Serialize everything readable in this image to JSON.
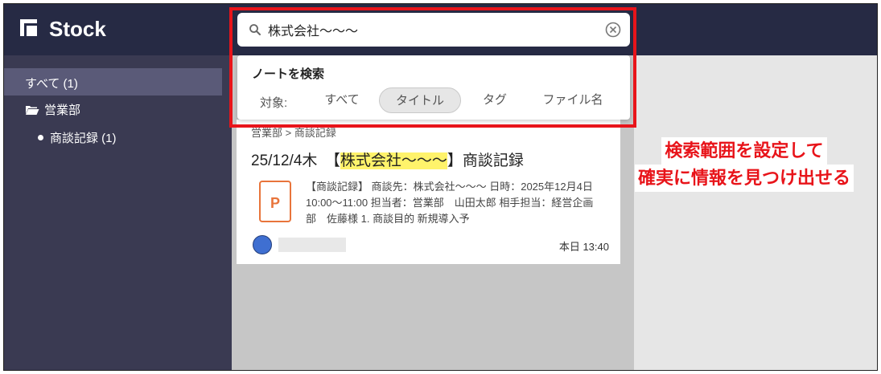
{
  "app": {
    "logo_text": "Stock"
  },
  "colors": {
    "topbar": "#262a44",
    "sidebar": "#3a3a52",
    "sidebar_selected": "#5a5a78",
    "highlight": "#fff36b",
    "annotation_red": "#e8141a",
    "file_icon": "#e8743b",
    "avatar": "#3f6fd1"
  },
  "sidebar": {
    "items": [
      {
        "label": "すべて (1)",
        "icon": "",
        "selected": true
      },
      {
        "label": "営業部",
        "icon": "folder-open-icon",
        "selected": false
      },
      {
        "label": "商談記録 (1)",
        "icon": "bullet-icon",
        "selected": false
      }
    ]
  },
  "search": {
    "value": "株式会社〜〜〜",
    "icon": "search-icon",
    "clear_icon": "clear-icon"
  },
  "search_dropdown": {
    "title": "ノートを検索",
    "scope_label": "対象:",
    "options": [
      {
        "label": "すべて",
        "selected": false
      },
      {
        "label": "タイトル",
        "selected": true
      },
      {
        "label": "タグ",
        "selected": false
      },
      {
        "label": "ファイル名",
        "selected": false
      }
    ]
  },
  "note": {
    "breadcrumb": "営業部 > 商談記録",
    "title_prefix": "25/12/4木　【",
    "title_highlight": "株式会社〜〜〜",
    "title_suffix": "】商談記録",
    "file_icon_letter": "P",
    "snippet": "【商談記録】 商談先：株式会社〜〜〜 日時：2025年12月4日 10:00〜11:00 担当者：営業部　山田太郎 相手担当：経営企画部　佐藤様 1. 商談目的 新規導入予",
    "time": "本日 13:40"
  },
  "annotation": {
    "line1": "検索範囲を設定して",
    "line2": "確実に情報を見つけ出せる"
  }
}
